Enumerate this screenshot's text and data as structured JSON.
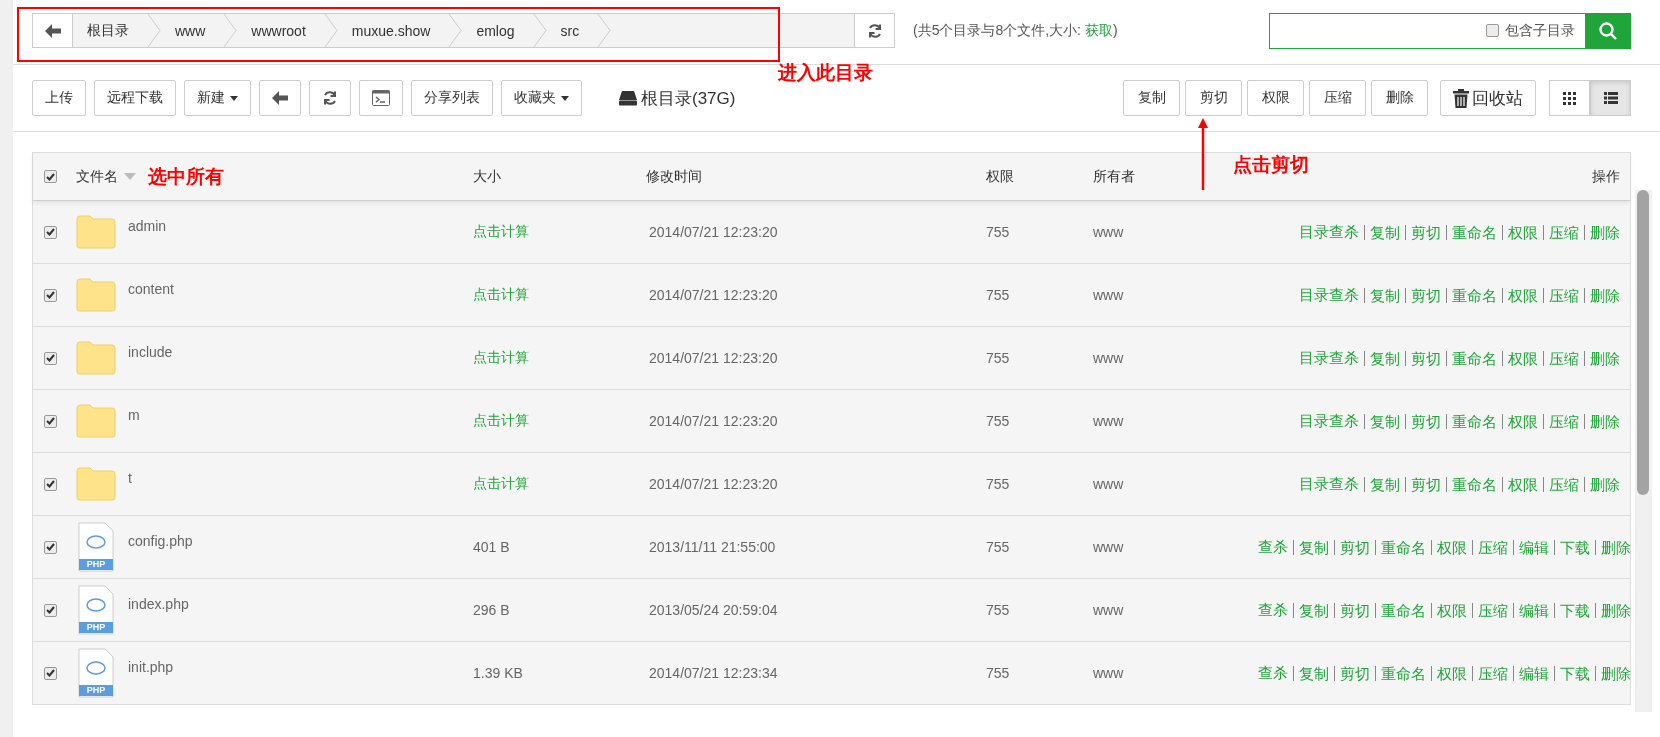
{
  "breadcrumb": {
    "items": [
      "根目录",
      "www",
      "wwwroot",
      "muxue.show",
      "emlog",
      "src"
    ]
  },
  "summary": {
    "prefix": "(共5个目录与8个文件,大小: ",
    "link": "获取",
    "suffix": ")"
  },
  "search": {
    "include_subdirs_label": "包含子目录",
    "include_subdirs_checked": false
  },
  "toolbar_left": [
    {
      "kind": "text",
      "label": "上传"
    },
    {
      "kind": "text",
      "label": "远程下载"
    },
    {
      "kind": "dropdown",
      "label": "新建"
    },
    {
      "kind": "back"
    },
    {
      "kind": "refresh"
    },
    {
      "kind": "terminal"
    },
    {
      "kind": "text",
      "label": "分享列表"
    },
    {
      "kind": "dropdown",
      "label": "收藏夹"
    }
  ],
  "disk": {
    "label": "根目录(37G)"
  },
  "toolbar_right": [
    "复制",
    "剪切",
    "权限",
    "压缩",
    "删除"
  ],
  "recycle": {
    "label": "回收站"
  },
  "view_toggle": [
    {
      "kind": "grid",
      "selected": false
    },
    {
      "kind": "list",
      "selected": true
    }
  ],
  "table": {
    "columns": [
      "文件名",
      "大小",
      "修改时间",
      "权限",
      "所有者",
      "操作"
    ],
    "all_checked": true,
    "rows": [
      {
        "kind": "folder",
        "name": "admin",
        "size": "点击计算",
        "modified": "2014/07/21 12:23:20",
        "permission": "755",
        "owner": "www",
        "checked": true,
        "actions": [
          "目录查杀",
          "复制",
          "剪切",
          "重命名",
          "权限",
          "压缩",
          "删除"
        ]
      },
      {
        "kind": "folder",
        "name": "content",
        "size": "点击计算",
        "modified": "2014/07/21 12:23:20",
        "permission": "755",
        "owner": "www",
        "checked": true,
        "actions": [
          "目录查杀",
          "复制",
          "剪切",
          "重命名",
          "权限",
          "压缩",
          "删除"
        ]
      },
      {
        "kind": "folder",
        "name": "include",
        "size": "点击计算",
        "modified": "2014/07/21 12:23:20",
        "permission": "755",
        "owner": "www",
        "checked": true,
        "actions": [
          "目录查杀",
          "复制",
          "剪切",
          "重命名",
          "权限",
          "压缩",
          "删除"
        ]
      },
      {
        "kind": "folder",
        "name": "m",
        "size": "点击计算",
        "modified": "2014/07/21 12:23:20",
        "permission": "755",
        "owner": "www",
        "checked": true,
        "actions": [
          "目录查杀",
          "复制",
          "剪切",
          "重命名",
          "权限",
          "压缩",
          "删除"
        ]
      },
      {
        "kind": "folder",
        "name": "t",
        "size": "点击计算",
        "modified": "2014/07/21 12:23:20",
        "permission": "755",
        "owner": "www",
        "checked": true,
        "actions": [
          "目录查杀",
          "复制",
          "剪切",
          "重命名",
          "权限",
          "压缩",
          "删除"
        ]
      },
      {
        "kind": "php",
        "icon_label": "PHP",
        "name": "config.php",
        "size": "401 B",
        "modified": "2013/11/11 21:55:00",
        "permission": "755",
        "owner": "www",
        "checked": true,
        "actions": [
          "查杀",
          "复制",
          "剪切",
          "重命名",
          "权限",
          "压缩",
          "编辑",
          "下载",
          "删除"
        ]
      },
      {
        "kind": "php",
        "icon_label": "PHP",
        "name": "index.php",
        "size": "296 B",
        "modified": "2013/05/24 20:59:04",
        "permission": "755",
        "owner": "www",
        "checked": true,
        "actions": [
          "查杀",
          "复制",
          "剪切",
          "重命名",
          "权限",
          "压缩",
          "编辑",
          "下载",
          "删除"
        ]
      },
      {
        "kind": "php",
        "icon_label": "PHP",
        "name": "init.php",
        "size": "1.39 KB",
        "modified": "2014/07/21 12:23:34",
        "permission": "755",
        "owner": "www",
        "checked": true,
        "actions": [
          "查杀",
          "复制",
          "剪切",
          "重命名",
          "权限",
          "压缩",
          "编辑",
          "下载",
          "删除"
        ]
      }
    ]
  },
  "annotations": {
    "breadcrumb_note": "进入此目录",
    "select_all_note": "选中所有",
    "cut_note": "点击剪切"
  }
}
